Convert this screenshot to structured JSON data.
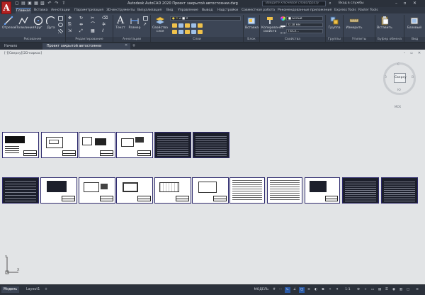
{
  "app": {
    "logo": "A",
    "window_title": "Autodesk AutoCAD 2020   Проект закрытой автостоянки.dwg",
    "search_placeholder": "Введите ключевое слово/фразу",
    "login": "Вход в службы",
    "qat_icons": [
      "new-icon",
      "open-icon",
      "save-icon",
      "saveas-icon",
      "plot-icon",
      "undo-icon",
      "redo-icon",
      "share-icon"
    ]
  },
  "ribbon_tabs": [
    "Главная",
    "Вставка",
    "Аннотации",
    "Параметризация",
    "3D-инструменты",
    "Визуализация",
    "Вид",
    "Управление",
    "Вывод",
    "Надстройки",
    "Совместная работа",
    "Рекомендованные приложения",
    "Express Tools",
    "Raster Tools"
  ],
  "ribbon": {
    "draw_buttons": [
      "Отрезок",
      "Полилиния",
      "Круг",
      "Дуга"
    ],
    "text_buttons": [
      "Текст",
      "Размер"
    ],
    "layer_properties": "Свойства слоя",
    "insert_label": "Вставка",
    "match_properties": "Копирование свойств",
    "group_label": "Группа",
    "measure_label": "Измерить",
    "paste_label": "Вставить",
    "base_label": "Базовый",
    "prop_color": "Белый",
    "prop_lineweight": "0.18 мм",
    "prop_linetype": "ПоСл...",
    "layer_value": "0",
    "panels": [
      "Рисование",
      "Редактирование",
      "Аннотации",
      "Слои",
      "Блок",
      "Свойства",
      "Группы",
      "Утилиты",
      "Буфер обмена",
      "Вид"
    ]
  },
  "file_tabs": [
    {
      "label": "Начало",
      "active": false
    },
    {
      "label": "Проект закрытой автостоянки",
      "active": true
    }
  ],
  "viewport": {
    "label": "[-][Сверху][2D-каркас]",
    "viewcube_face": "Сверху",
    "compass": {
      "n": "С",
      "s": "Ю",
      "w": "З",
      "e": "В"
    },
    "wcs": "МСК"
  },
  "status": {
    "layout_tabs": [
      "Модель",
      "Layout1"
    ],
    "model_label": "МОДЕЛЬ",
    "scale": "1:1"
  },
  "colors": {
    "ribbon_bg": "#3c4555",
    "titlebar_bg": "#2b313b",
    "viewport_bg": "#e2e4e6",
    "sheet_border": "#2e2a6e",
    "accent": "#2b5aa6"
  }
}
